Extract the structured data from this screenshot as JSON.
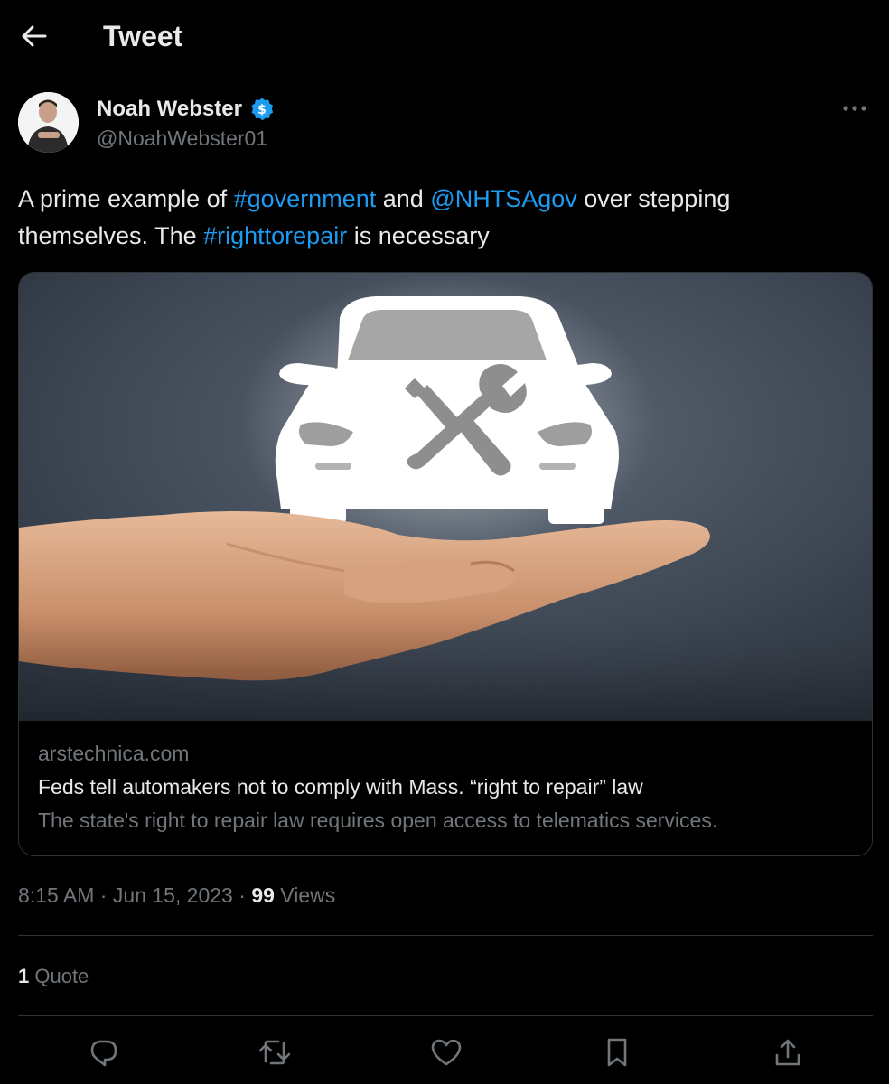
{
  "header": {
    "title": "Tweet",
    "back_icon": "arrow-left-icon"
  },
  "author": {
    "name": "Noah Webster",
    "handle": "@NoahWebster01",
    "verified_icon": "verified-badge-icon",
    "more_icon": "more-horizontal-icon"
  },
  "tweet": {
    "text_1": "A prime example of ",
    "hashtag_1": "#government",
    "text_2": " and ",
    "mention_1": "@NHTSAgov",
    "text_3": " over stepping themselves. The ",
    "hashtag_2": "#righttorepair",
    "text_4": " is necessary"
  },
  "card": {
    "domain": "arstechnica.com",
    "title": "Feds tell automakers not to comply with Mass. “right to repair” law",
    "description": "The state's right to repair law requires open access to telematics services."
  },
  "meta": {
    "time": "8:15 AM",
    "sep1": " · ",
    "date": "Jun 15, 2023",
    "sep2": " · ",
    "views_count": "99",
    "views_label": " Views"
  },
  "stats": {
    "quote_count": "1",
    "quote_label": " Quote"
  },
  "actions": {
    "reply_icon": "reply-icon",
    "retweet_icon": "retweet-icon",
    "like_icon": "heart-icon",
    "bookmark_icon": "bookmark-icon",
    "share_icon": "share-icon"
  },
  "colors": {
    "background": "#000000",
    "text_primary": "#e7e9ea",
    "text_secondary": "#71767b",
    "link": "#1d9bf0",
    "border": "#2f3336"
  }
}
